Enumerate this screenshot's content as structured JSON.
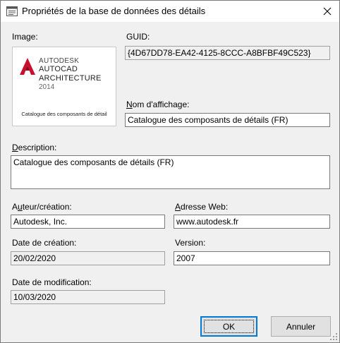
{
  "window": {
    "title": "Propriétés de la base de données des détails",
    "icon": "dialog-window-icon",
    "close_icon": "close-icon"
  },
  "image": {
    "label": "Image:",
    "brand": "AUTODESK",
    "product_line1": "AUTOCAD",
    "product_line2": "ARCHITECTURE",
    "year": "2014",
    "caption": "Catalogue des composants de détail"
  },
  "guid": {
    "label": "GUID:",
    "value": "{4D67DD78-EA42-4125-8CCC-A8BFBF49C523}"
  },
  "display_name": {
    "label_prefix": "N",
    "label_rest": "om d'affichage:",
    "value": "Catalogue des composants de détails (FR)"
  },
  "description": {
    "label_prefix": "D",
    "label_rest": "escription:",
    "value": "Catalogue des composants de détails (FR)"
  },
  "author": {
    "label_prefix": "A",
    "label_access": "u",
    "label_rest": "teur/création:",
    "value": "Autodesk, Inc."
  },
  "web": {
    "label_prefix": "A",
    "label_rest": "dresse Web:",
    "value": "www.autodesk.fr"
  },
  "created": {
    "label": "Date de création:",
    "value": "20/02/2020"
  },
  "version": {
    "label": "Version:",
    "value": "2007"
  },
  "modified": {
    "label": "Date de modification:",
    "value": "10/03/2020"
  },
  "buttons": {
    "ok": "OK",
    "cancel": "Annuler"
  },
  "colors": {
    "accent": "#0078d7",
    "logo_red": "#c8102e"
  }
}
